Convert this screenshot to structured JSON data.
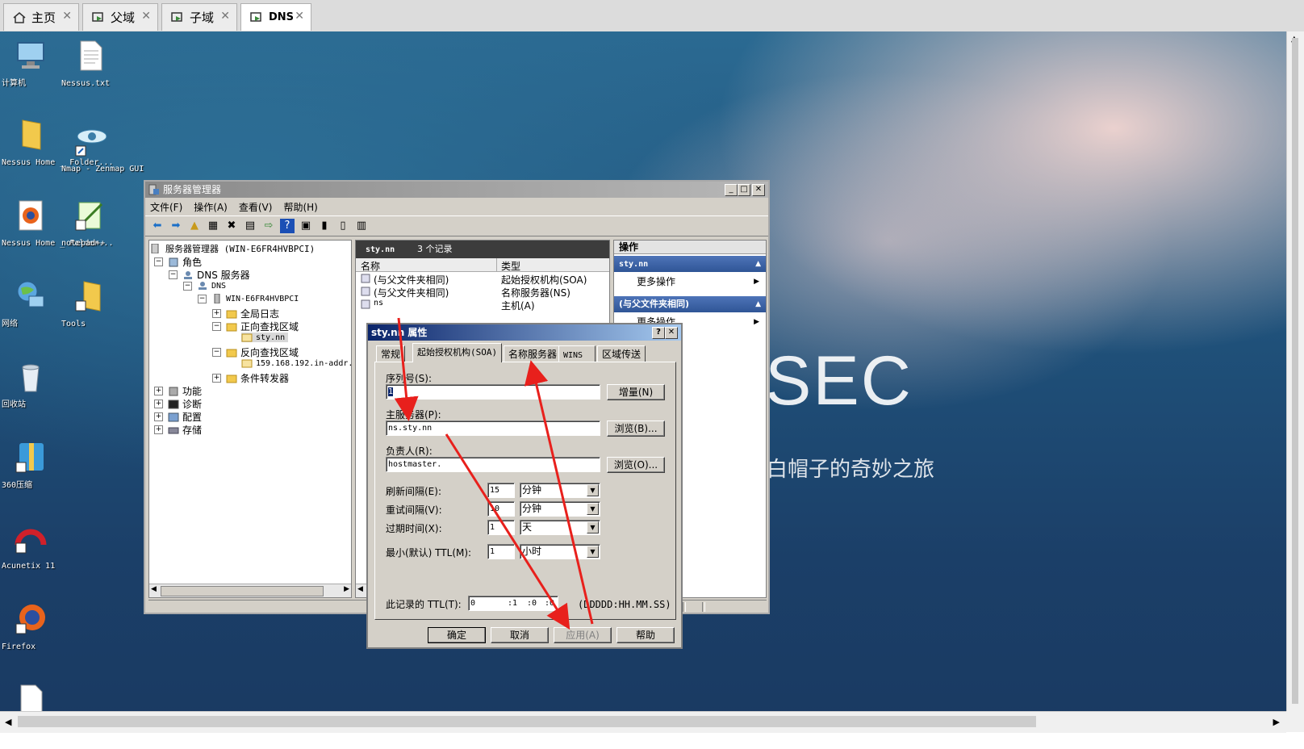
{
  "tabs": [
    {
      "label": "主页",
      "icon": "home-icon"
    },
    {
      "label": "父域",
      "icon": "vm-icon"
    },
    {
      "label": "子域",
      "icon": "vm-icon"
    },
    {
      "label": "DNS",
      "icon": "vm-icon"
    }
  ],
  "desktop": {
    "icons": [
      {
        "label": "计算机",
        "icon": "computer-icon"
      },
      {
        "label": "Nessus.txt",
        "icon": "text-file-icon"
      },
      {
        "label": "Nessus Home _ Folder...",
        "icon": "folder-icon"
      },
      {
        "label": "Nmap - Zenmap GUI",
        "icon": "nmap-eye-icon"
      },
      {
        "label": "Nessus Home _ Folder...",
        "icon": "firefox-icon"
      },
      {
        "label": "notepad++",
        "icon": "notepad-icon"
      },
      {
        "label": "网络",
        "icon": "network-icon"
      },
      {
        "label": "Tools",
        "icon": "folder-icon"
      },
      {
        "label": "回收站",
        "icon": "recycle-bin-icon"
      },
      {
        "label": "360压缩",
        "icon": "zip-icon"
      },
      {
        "label": "Acunetix 11",
        "icon": "acunetix-icon"
      },
      {
        "label": "Firefox",
        "icon": "firefox-icon"
      }
    ],
    "watermark_big": "SEC",
    "watermark_sub": "白帽子的奇妙之旅"
  },
  "server_manager": {
    "title": "服务器管理器",
    "menu": [
      "文件(F)",
      "操作(A)",
      "查看(V)",
      "帮助(H)"
    ],
    "tree": {
      "root": "服务器管理器 (WIN-E6FR4HVBPCI)",
      "roles": "角色",
      "dns_server": "DNS 服务器",
      "dns": "DNS",
      "host": "WIN-E6FR4HVBPCI",
      "global_logs": "全局日志",
      "forward_zones": "正向查找区域",
      "zone": "sty.nn",
      "reverse_zones": "反向查找区域",
      "reverse_zone": "159.168.192.in-addr.",
      "forwarders": "条件转发器",
      "features": "功能",
      "diagnostics": "诊断",
      "configuration": "配置",
      "storage": "存储"
    },
    "list": {
      "zone_name": "sty.nn",
      "record_count": "3 个记录",
      "col_name": "名称",
      "col_type": "类型",
      "rows": [
        {
          "name": "(与父文件夹相同)",
          "type": "起始授权机构(SOA)"
        },
        {
          "name": "(与父文件夹相同)",
          "type": "名称服务器(NS)"
        },
        {
          "name": "ns",
          "type": "主机(A)"
        }
      ]
    },
    "actions": {
      "header": "操作",
      "section1": "sty.nn",
      "more1": "更多操作",
      "section2": "(与父文件夹相同)",
      "more2": "更多操作"
    }
  },
  "dialog": {
    "title": "sty.nn 属性",
    "tabs": [
      "常规",
      "起始授权机构(SOA)",
      "名称服务器",
      "WINS",
      "区域传送"
    ],
    "serial_label": "序列号(S):",
    "serial_value": "1",
    "increment_btn": "增量(N)",
    "primary_label": "主服务器(P):",
    "primary_value": "ns.sty.nn",
    "browse_b": "浏览(B)...",
    "responsible_label": "负责人(R):",
    "responsible_value": "hostmaster.",
    "browse_o": "浏览(O)...",
    "refresh_label": "刷新间隔(E):",
    "refresh_value": "15",
    "refresh_unit": "分钟",
    "retry_label": "重试间隔(V):",
    "retry_value": "10",
    "retry_unit": "分钟",
    "expire_label": "过期时间(X):",
    "expire_value": "1",
    "expire_unit": "天",
    "minttl_label": "最小(默认) TTL(M):",
    "minttl_value": "1",
    "minttl_unit": "小时",
    "ttl_label": "此记录的 TTL(T):",
    "ttl_d": "0",
    "ttl_h": ":1",
    "ttl_m": ":0",
    "ttl_s": ":0",
    "ttl_format": "(DDDDD:HH.MM.SS)",
    "ok": "确定",
    "cancel": "取消",
    "apply": "应用(A)",
    "help": "帮助"
  },
  "colors": {
    "annotation_arrow": "#e8201c",
    "title_blue": "#0a246a",
    "action_header": "#2f5596"
  }
}
